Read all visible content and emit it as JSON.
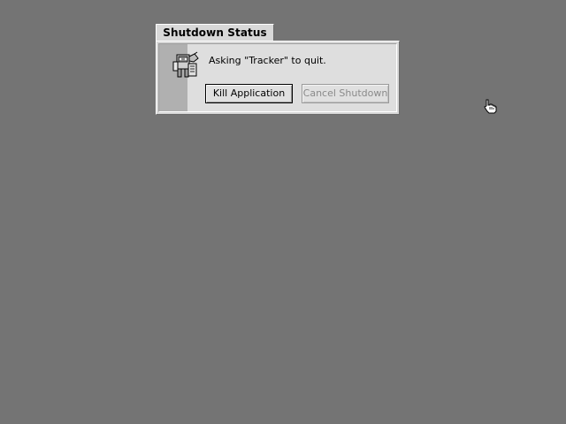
{
  "window": {
    "title": "Shutdown Status",
    "message": "Asking \"Tracker\" to quit.",
    "icon": "shutdown-app-icon"
  },
  "buttons": {
    "kill_label": "Kill Application",
    "cancel_label": "Cancel Shutdown",
    "cancel_enabled": false
  },
  "desktop": {
    "background_color": "#747474"
  },
  "cursor": {
    "icon": "hand-pointer-icon"
  }
}
